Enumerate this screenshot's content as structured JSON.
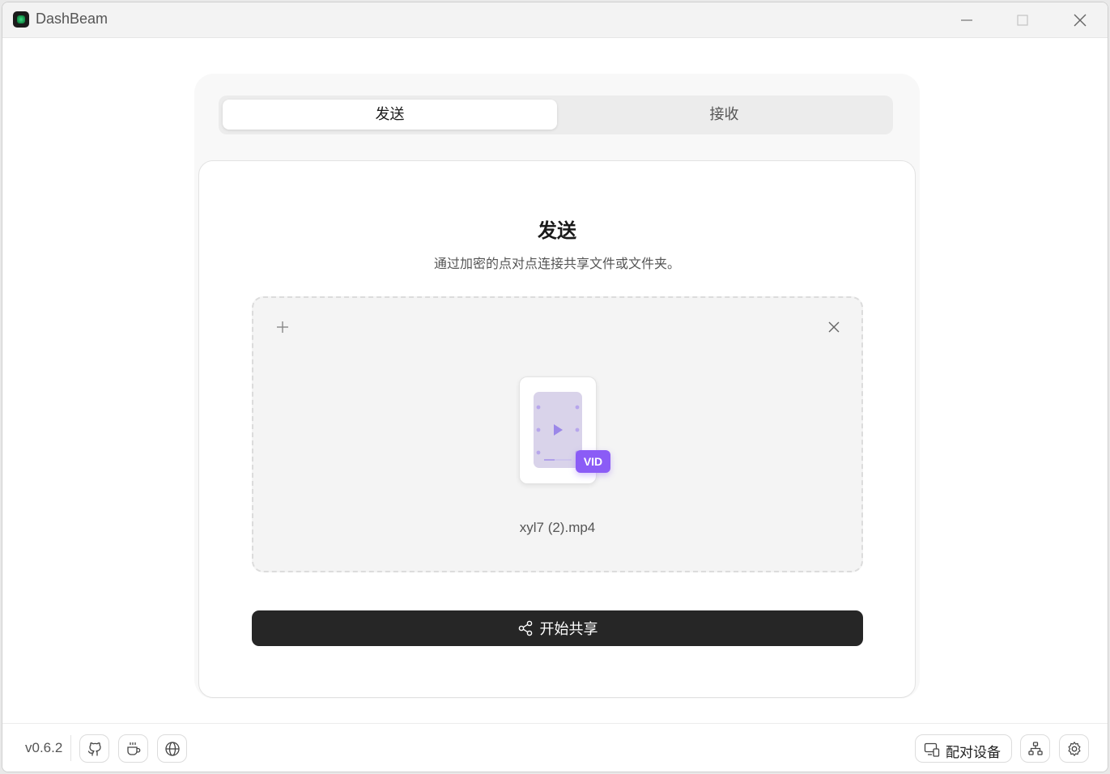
{
  "window": {
    "title": "DashBeam"
  },
  "tabs": [
    {
      "label": "发送",
      "active": true
    },
    {
      "label": "接收",
      "active": false
    }
  ],
  "send": {
    "title": "发送",
    "subtitle": "通过加密的点对点连接共享文件或文件夹。",
    "file": {
      "name": "xyl7 (2).mp4",
      "badge": "VID"
    },
    "share_button": "开始共享"
  },
  "footer": {
    "version": "v0.6.2",
    "pair_button": "配对设备"
  },
  "icons": {
    "add": "plus-icon",
    "clear": "close-icon",
    "share": "share-icon",
    "github": "github-icon",
    "coffee": "coffee-icon",
    "globe": "globe-icon",
    "pair": "devices-icon",
    "network": "network-icon",
    "settings": "gear-icon"
  },
  "colors": {
    "accent": "#8b5cf6",
    "primary_button": "#262626",
    "film": "#d9d3ea"
  }
}
